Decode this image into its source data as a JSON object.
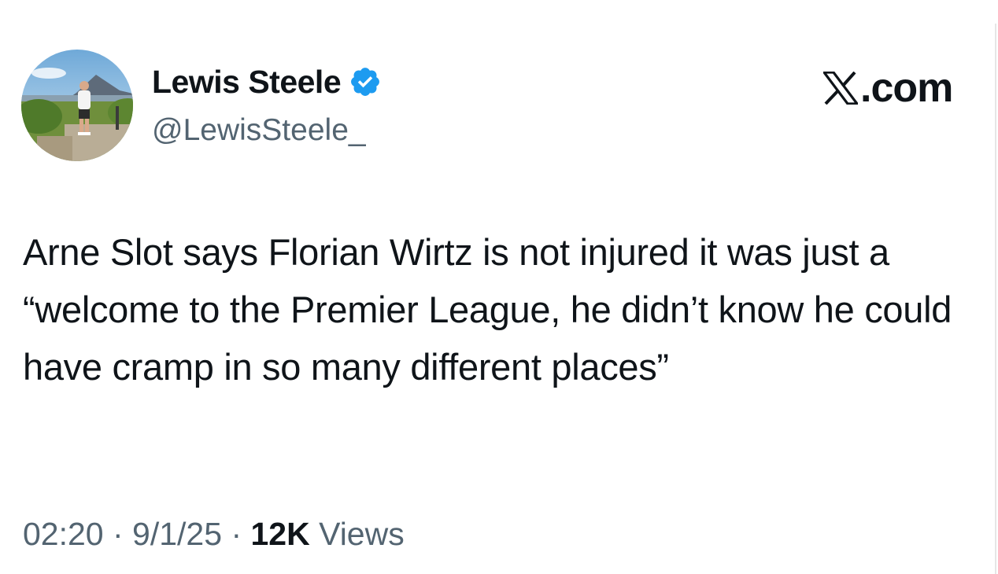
{
  "author": {
    "display_name": "Lewis Steele",
    "handle": "@LewisSteele_",
    "verified": true,
    "verified_badge_color": "#1d9bf0"
  },
  "brand": {
    "label": ".com",
    "logo_icon": "x-logo-icon"
  },
  "tweet": {
    "text": "Arne Slot says Florian Wirtz is not injured it was just a “welcome to the Premier League, he didn’t know he could have cramp in so many different places”"
  },
  "meta": {
    "time": "02:20",
    "separator": " · ",
    "date": "9/1/25",
    "views_count": "12K",
    "views_label": " Views"
  },
  "colors": {
    "text_primary": "#0f1419",
    "text_secondary": "#536471",
    "background": "#ffffff"
  }
}
